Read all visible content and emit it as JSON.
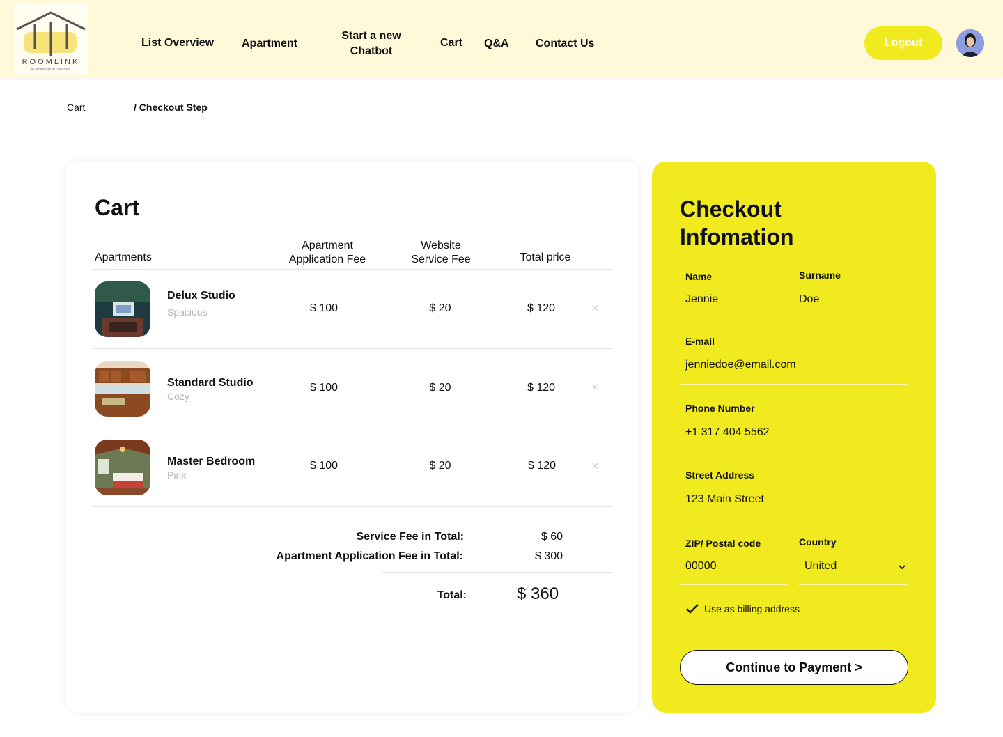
{
  "brand": {
    "name": "ROOMLINK",
    "tagline": "#1 APARTMENT SEEKER",
    "accent": "#f0ea1e",
    "header_bg": "#fff8d9"
  },
  "nav": {
    "list_overview": "List Overview",
    "apartment": "Apartment",
    "chatbot_line1": "Start a new",
    "chatbot_line2": "Chatbot",
    "cart": "Cart",
    "qa": "Q&A",
    "contact": "Contact Us",
    "logout": "Logout"
  },
  "breadcrumb": {
    "root": "Cart",
    "current": "/ Checkout Step"
  },
  "cart": {
    "title": "Cart",
    "headers": {
      "apartments": "Apartments",
      "app_fee_line1": "Apartment",
      "app_fee_line2": "Application Fee",
      "service_line1": "Website",
      "service_line2": "Service Fee",
      "total": "Total price"
    },
    "items": [
      {
        "name": "Delux Studio",
        "subtitle": "Spacious",
        "app_fee": "$ 100",
        "service_fee": "$ 20",
        "total": "$ 120",
        "remove": "×"
      },
      {
        "name": "Standard Studio",
        "subtitle": "Cozy",
        "app_fee": "$ 100",
        "service_fee": "$ 20",
        "total": "$ 120",
        "remove": "×"
      },
      {
        "name": "Master Bedroom",
        "subtitle": "Pink",
        "app_fee": "$ 100",
        "service_fee": "$ 20",
        "total": "$ 120",
        "remove": "×"
      }
    ],
    "summary": {
      "service_label": "Service Fee in Total:",
      "service_value": "$ 60",
      "app_label": "Apartment Application Fee in Total:",
      "app_value": "$ 300",
      "total_label": "Total:",
      "total_value": "$ 360"
    }
  },
  "checkout": {
    "title_line1": "Checkout",
    "title_line2": "Infomation",
    "name_label": "Name",
    "name_value": "Jennie",
    "surname_label": "Surname",
    "surname_value": "Doe",
    "email_label": "E-mail",
    "email_value": "jenniedoe@email.com",
    "phone_label": "Phone Number",
    "phone_value": "+1 317 404 5562",
    "street_label": "Street Address",
    "street_value": "123 Main Street",
    "zip_label": "ZIP/ Postal code",
    "zip_value": "00000",
    "country_label": "Country",
    "country_value": "United",
    "billing_label": "Use as billing address",
    "billing_checked": true,
    "pay_button": "Continue to Payment >"
  }
}
